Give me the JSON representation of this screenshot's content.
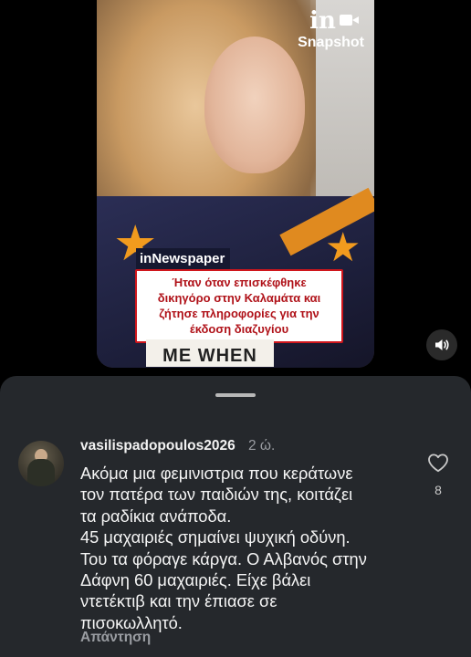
{
  "video": {
    "logo_mark": "in",
    "logo_sub": "Snapshot",
    "tag": "inNewspaper",
    "headline_lines": [
      "Ήταν όταν επισκέφθηκε",
      "δικηγόρο στην Καλαμάτα και",
      "ζήτησε πληροφορίες για την",
      "έκδοση διαζυγίου"
    ],
    "banner_text": "ME WHEN"
  },
  "sheet": {
    "comment": {
      "username": "vasilispadopoulos2026",
      "time": "2 ώ.",
      "lines": [
        "Ακόμα μια φεμινιστρια που κεράτωνε",
        "τον πατέρα των παιδιών της, κοιτάζει",
        "τα ραδίκια ανάποδα.",
        "45 μαχαιριές σημαίνει ψυχική οδύνη.",
        "Του τα φόραγε κάργα. Ο Αλβανός στην",
        "Δάφνη 60 μαχαιριές. Είχε βάλει",
        "ντετέκτιβ και την έπιασε σε",
        "πισοκωλλητό."
      ],
      "reply_label": "Απάντηση",
      "like_count": "8"
    }
  },
  "icons": {
    "mute": "speaker-icon",
    "like": "heart-icon",
    "camera": "video-camera-icon"
  },
  "colors": {
    "sheet_bg": "#25282c",
    "headline_red": "#b01219",
    "accent_orange": "#f29b1e"
  }
}
